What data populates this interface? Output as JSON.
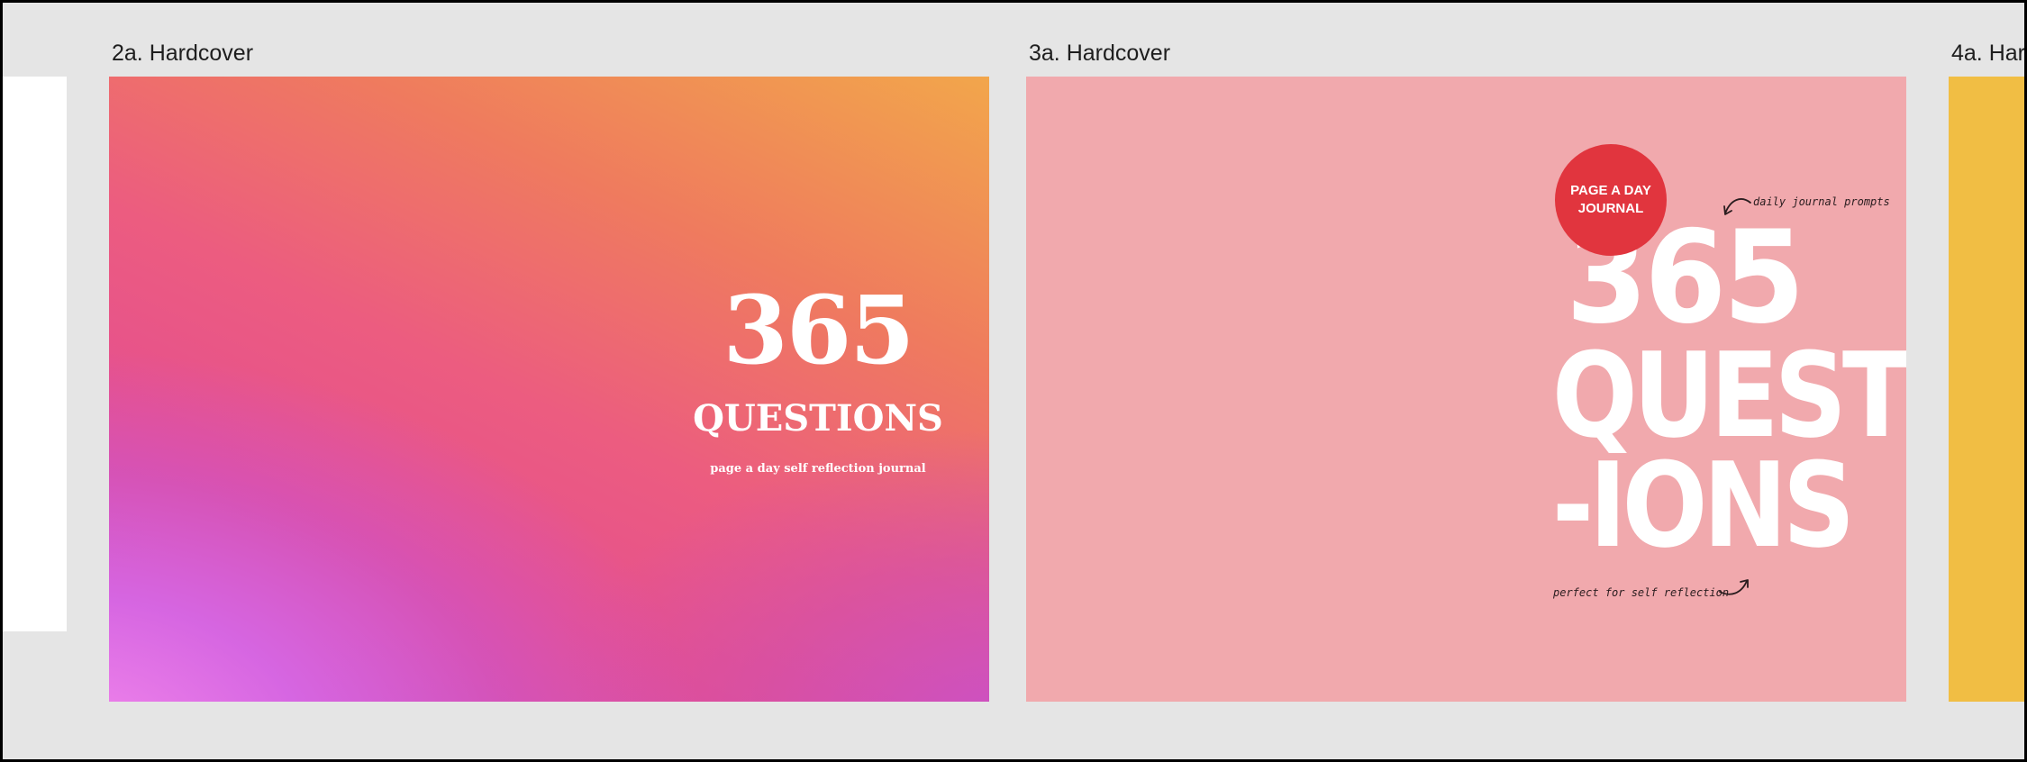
{
  "canvas": {
    "frames": [
      {
        "label": "2a. Hardcover"
      },
      {
        "label": "3a. Hardcover"
      },
      {
        "label": "4a. Har"
      }
    ]
  },
  "cover_2a": {
    "number": "365",
    "title": "QUESTIONS",
    "subtitle": "page a day self reflection journal",
    "gradient_colors": [
      "#f2a64b",
      "#ef7b5e",
      "#ec5c80",
      "#d050b0",
      "#f58aec"
    ]
  },
  "cover_3a": {
    "badge": "PAGE A DAY JOURNAL",
    "number": "365",
    "line1": "QUEST",
    "line2": "-IONS",
    "note_top": "daily journal prompts",
    "note_bottom": "perfect for self reflection",
    "background_color": "#f1a9ad",
    "badge_color": "#e1353e"
  },
  "cover_4a": {
    "background_color": "#f1be44"
  },
  "cover_1": {
    "background_color": "#ffffff"
  }
}
